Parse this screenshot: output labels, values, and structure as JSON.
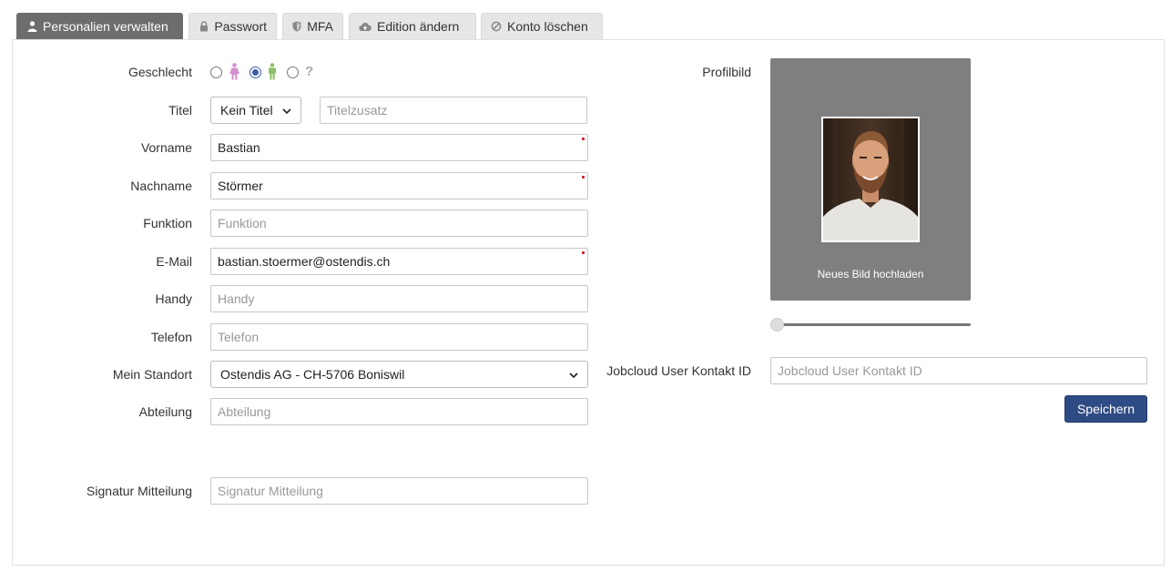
{
  "tabs": [
    {
      "label": "Personalien verwalten",
      "icon": "user-icon"
    },
    {
      "label": "Passwort",
      "icon": "lock-icon"
    },
    {
      "label": "MFA",
      "icon": "shield-icon"
    },
    {
      "label": "Edition ändern",
      "icon": "cloud-upload-icon"
    },
    {
      "label": "Konto löschen",
      "icon": "ban-icon"
    }
  ],
  "form": {
    "gender_label": "Geschlecht",
    "gender_options": [
      "female-icon",
      "male-icon",
      "unknown-icon"
    ],
    "gender_unknown_glyph": "?",
    "gender_selected": "male",
    "title_label": "Titel",
    "title_select_value": "Kein Titel",
    "title_suffix_placeholder": "Titelzusatz",
    "firstname_label": "Vorname",
    "firstname_value": "Bastian",
    "lastname_label": "Nachname",
    "lastname_value": "Störmer",
    "function_label": "Funktion",
    "function_placeholder": "Funktion",
    "email_label": "E-Mail",
    "email_value": "bastian.stoermer@ostendis.ch",
    "mobile_label": "Handy",
    "mobile_placeholder": "Handy",
    "phone_label": "Telefon",
    "phone_placeholder": "Telefon",
    "location_label": "Mein Standort",
    "location_value": "Ostendis AG - CH-5706 Boniswil",
    "department_label": "Abteilung",
    "department_placeholder": "Abteilung",
    "signature_label": "Signatur Mitteilung",
    "signature_placeholder": "Signatur Mitteilung"
  },
  "profile": {
    "label": "Profilbild",
    "upload_text": "Neues Bild hochladen",
    "zoom_level": 0
  },
  "jobcloud": {
    "label": "Jobcloud User Kontakt ID",
    "placeholder": "Jobcloud User Kontakt ID"
  },
  "actions": {
    "save_label": "Speichern"
  },
  "colors": {
    "active_tab": "#6d6d6d",
    "primary_button": "#2f4b85",
    "female_icon": "#d48fce",
    "male_icon": "#8fbf6a",
    "required_marker": "#d40000"
  }
}
